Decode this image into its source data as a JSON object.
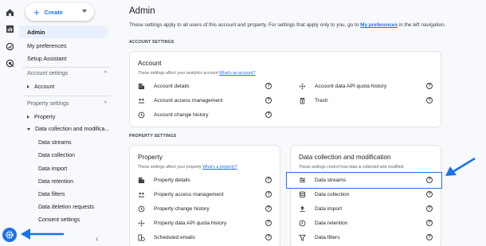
{
  "rail": {
    "icons": [
      "home-icon",
      "reports-icon",
      "explore-icon",
      "advertising-icon"
    ],
    "settings_icon": "gear-icon"
  },
  "sidebar": {
    "create_label": "Create",
    "admin_label": "Admin",
    "my_preferences": "My preferences",
    "setup_assistant": "Setup Assistant",
    "account_settings_head": "Account settings",
    "account_item": "Account",
    "property_settings_head": "Property settings",
    "property_item": "Property",
    "data_collection_item": "Data collection and modifica...",
    "sub_items": [
      "Data streams",
      "Data collection",
      "Data import",
      "Data retention",
      "Data filters",
      "Data deletion requests",
      "Consent settings"
    ]
  },
  "main": {
    "title": "Admin",
    "subtitle_pre": "These settings apply to all users of this account and property. For settings that apply only to you, go to",
    "subtitle_link": "My preferences",
    "subtitle_post": "in the left navigation.",
    "account_section_label": "ACCOUNT SETTINGS",
    "property_section_label": "PROPERTY SETTINGS",
    "account_card": {
      "title": "Account",
      "desc": "These settings affect your analytics account",
      "desc_link": "What's an account?",
      "left_rows": [
        "Account details",
        "Account access management",
        "Account change history"
      ],
      "right_rows": [
        "Account data API quota history",
        "Trash"
      ]
    },
    "property_card": {
      "title": "Property",
      "desc": "These settings affect your property",
      "desc_link": "What's a property?",
      "rows": [
        "Property details",
        "Property access management",
        "Property change history",
        "Property data API quota history",
        "Scheduled emails"
      ]
    },
    "datacoll_card": {
      "title": "Data collection and modification",
      "desc": "These settings control how data is collected and modified",
      "rows": [
        "Data streams",
        "Data collection",
        "Data import",
        "Data retention",
        "Data filters"
      ]
    }
  },
  "colors": {
    "accent": "#1a73e8",
    "active_bg": "#e8f0fe",
    "page_bg": "#f7f9fc"
  }
}
